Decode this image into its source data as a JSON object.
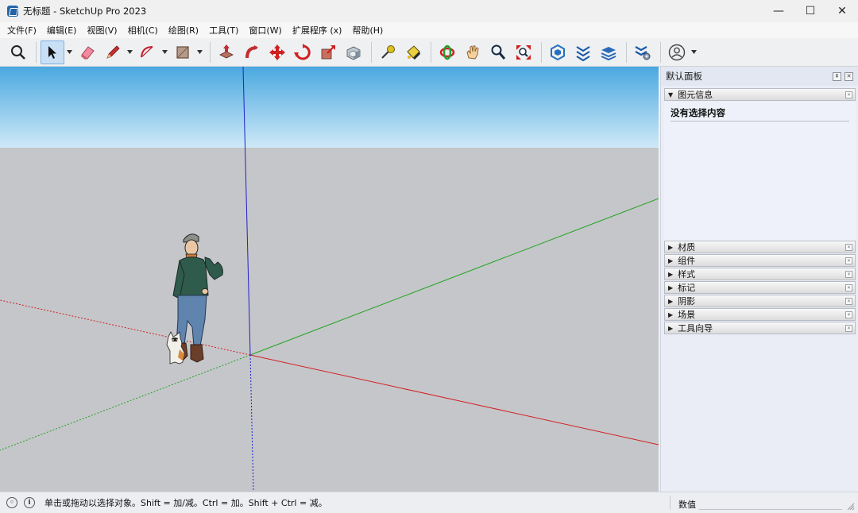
{
  "app": {
    "title": "无标题 - SketchUp Pro 2023"
  },
  "window_controls": {
    "minimize": "—",
    "maximize": "☐",
    "close": "✕"
  },
  "menu": [
    {
      "label": "文件(F)"
    },
    {
      "label": "编辑(E)"
    },
    {
      "label": "视图(V)"
    },
    {
      "label": "相机(C)"
    },
    {
      "label": "绘图(R)"
    },
    {
      "label": "工具(T)"
    },
    {
      "label": "窗口(W)"
    },
    {
      "label": "扩展程序 (x)"
    },
    {
      "label": "帮助(H)"
    }
  ],
  "toolbar": {
    "active_tool": "select-tool",
    "tools": [
      "search-icon",
      "select-arrow-icon",
      "eraser-icon",
      "pencil-icon",
      "arc-icon",
      "rectangle-icon",
      "push-pull-icon",
      "follow-me-icon",
      "move-icon",
      "rotate-icon",
      "scale-icon",
      "offset-icon",
      "tape-measure-icon",
      "paint-bucket-icon",
      "orbit-icon",
      "pan-icon",
      "zoom-icon",
      "zoom-extents-icon",
      "3d-warehouse-icon",
      "extension-warehouse-icon",
      "layout-icon",
      "extension-manager-icon",
      "account-icon"
    ]
  },
  "panel": {
    "title": "默认面板",
    "entity_info": {
      "heading": "图元信息",
      "message": "没有选择内容"
    },
    "trays": [
      {
        "label": "材质"
      },
      {
        "label": "组件"
      },
      {
        "label": "样式"
      },
      {
        "label": "标记"
      },
      {
        "label": "阴影"
      },
      {
        "label": "场景"
      },
      {
        "label": "工具向导"
      }
    ]
  },
  "statusbar": {
    "hint": "单击或拖动以选择对象。Shift = 加/减。Ctrl = 加。Shift + Ctrl = 减。",
    "vcb_label": "数值",
    "vcb_value": ""
  },
  "colors": {
    "sky_top": "#4aa8e0",
    "sky_bottom": "#cfe9f7",
    "ground": "#c5c6ca",
    "axis_red": "#d22020",
    "axis_green": "#22a422",
    "axis_blue": "#2020c8"
  }
}
